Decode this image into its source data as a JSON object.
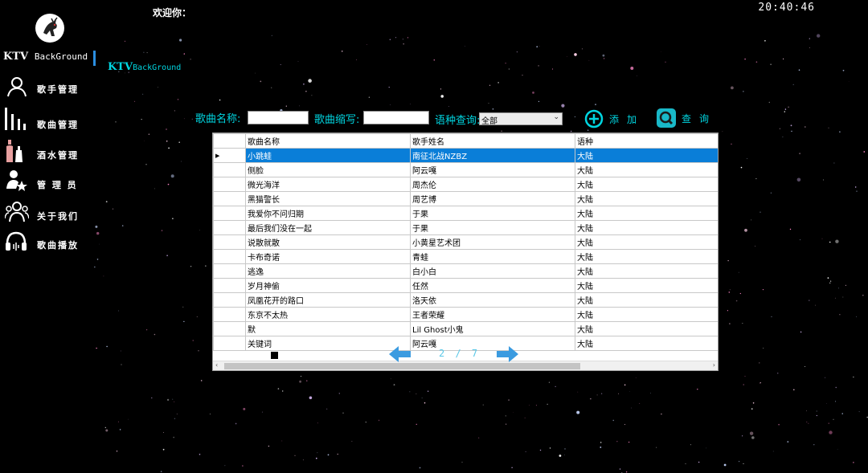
{
  "header": {
    "welcome": "欢迎你：",
    "clock": "20:40:46"
  },
  "sidebar": {
    "brand_main": "KTV",
    "brand_sub": "BackGround",
    "items": [
      {
        "label": "歌手管理",
        "icon": "user-icon"
      },
      {
        "label": "歌曲管理",
        "icon": "bars-icon"
      },
      {
        "label": "酒水管理",
        "icon": "bottles-icon"
      },
      {
        "label": "管 理 员",
        "icon": "admin-star-icon"
      },
      {
        "label": "关于我们",
        "icon": "group-icon"
      },
      {
        "label": "歌曲播放",
        "icon": "headphones-icon"
      }
    ]
  },
  "content": {
    "title_main": "KTV",
    "title_sub": "BackGround",
    "search": {
      "song_name_label": "歌曲名称:",
      "song_name_value": "",
      "abbr_label": "歌曲缩写:",
      "abbr_value": "",
      "lang_label": "语种查询:",
      "lang_selected": "全部",
      "add_label": "添加",
      "query_label": "查询"
    },
    "grid": {
      "columns": [
        "歌曲名称",
        "歌手姓名",
        "语种"
      ],
      "selected_index": 0,
      "rows": [
        [
          "小跳蛙",
          "南征北战NZBZ",
          "大陆"
        ],
        [
          "侧脸",
          "阿云嘎",
          "大陆"
        ],
        [
          "微光海洋",
          "周杰伦",
          "大陆"
        ],
        [
          "黑猫警长",
          "周艺博",
          "大陆"
        ],
        [
          "我爱你不问归期",
          "于果",
          "大陆"
        ],
        [
          "最后我们没在一起",
          "于果",
          "大陆"
        ],
        [
          "说散就散",
          "小黄星艺术团",
          "大陆"
        ],
        [
          "卡布奇诺",
          "青蛙",
          "大陆"
        ],
        [
          "逃逸",
          "白小白",
          "大陆"
        ],
        [
          "岁月神偷",
          "任然",
          "大陆"
        ],
        [
          "凤凰花开的路口",
          "洛天依",
          "大陆"
        ],
        [
          "东京不太热",
          "王者荣耀",
          "大陆"
        ],
        [
          "默",
          "Lil Ghost小鬼",
          "大陆"
        ],
        [
          "关键词",
          "阿云嘎",
          "大陆"
        ]
      ]
    },
    "pager": {
      "text": "2 / 7"
    }
  },
  "colors": {
    "accent_cyan": "#00d5e0",
    "selection_blue": "#0a7ed8",
    "arrow_blue": "#3b9be0"
  }
}
